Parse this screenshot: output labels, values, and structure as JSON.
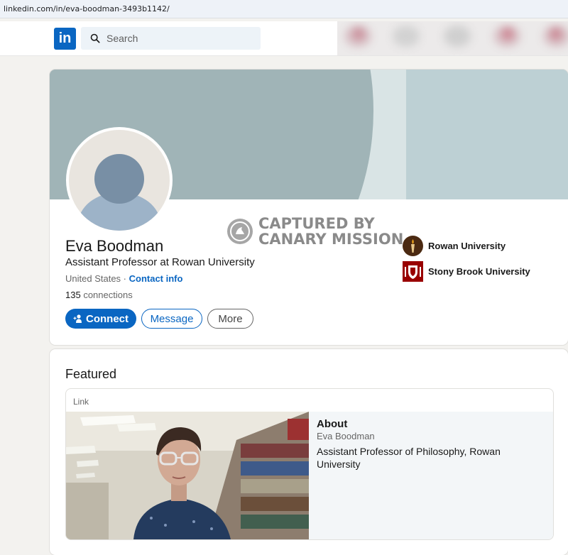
{
  "browser": {
    "url": "linkedin.com/in/eva-boodman-3493b1142/"
  },
  "nav": {
    "logo": "in",
    "search_placeholder": "Search"
  },
  "profile": {
    "name": "Eva Boodman",
    "headline": "Assistant Professor at Rowan University",
    "location": "United States",
    "separator": " · ",
    "contact_info": "Contact info",
    "connections_count": "135",
    "connections_label": " connections",
    "buttons": {
      "connect": "Connect",
      "message": "Message",
      "more": "More"
    },
    "education": [
      {
        "name": "Rowan University",
        "logo": "rowan-torch-icon"
      },
      {
        "name": "Stony Brook University",
        "logo": "stony-brook-shield-icon"
      }
    ]
  },
  "watermark": {
    "line1": "CAPTURED BY",
    "line2": "CANARY MISSION"
  },
  "featured": {
    "title": "Featured",
    "item": {
      "type_label": "Link",
      "title": "About",
      "subtitle": "Eva Boodman",
      "description": "Assistant Professor of Philosophy, Rowan University"
    }
  },
  "colors": {
    "brand": "#0a66c2",
    "background": "#f3f2ef",
    "cover": "#a0b4b7"
  }
}
